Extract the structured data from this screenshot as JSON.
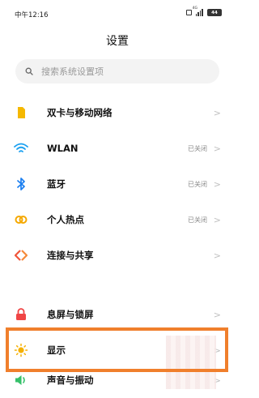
{
  "status_bar": {
    "time": "中午12:16",
    "battery": "44"
  },
  "header": {
    "title": "设置"
  },
  "search": {
    "placeholder": "搜索系统设置项"
  },
  "rows": [
    {
      "label": "双卡与移动网络",
      "value": "",
      "icon": "sim-card-icon",
      "color": "#f5b800"
    },
    {
      "label": "WLAN",
      "value": "已关闭",
      "icon": "wifi-icon",
      "color": "#1aa0f0"
    },
    {
      "label": "蓝牙",
      "value": "已关闭",
      "icon": "bluetooth-icon",
      "color": "#1a7ef0"
    },
    {
      "label": "个人热点",
      "value": "已关闭",
      "icon": "hotspot-icon",
      "color": "#f5a800"
    },
    {
      "label": "连接与共享",
      "value": "",
      "icon": "connection-share-icon",
      "color": "#f0553a"
    },
    {
      "label": "息屏与锁屏",
      "value": "",
      "icon": "lock-icon",
      "color": "#f04545"
    },
    {
      "label": "显示",
      "value": "",
      "icon": "sun-icon",
      "color": "#f5b000"
    },
    {
      "label": "声音与振动",
      "value": "",
      "icon": "speaker-icon",
      "color": "#35c06a"
    }
  ],
  "chevron": ">",
  "highlight_color": "#f07f2c"
}
